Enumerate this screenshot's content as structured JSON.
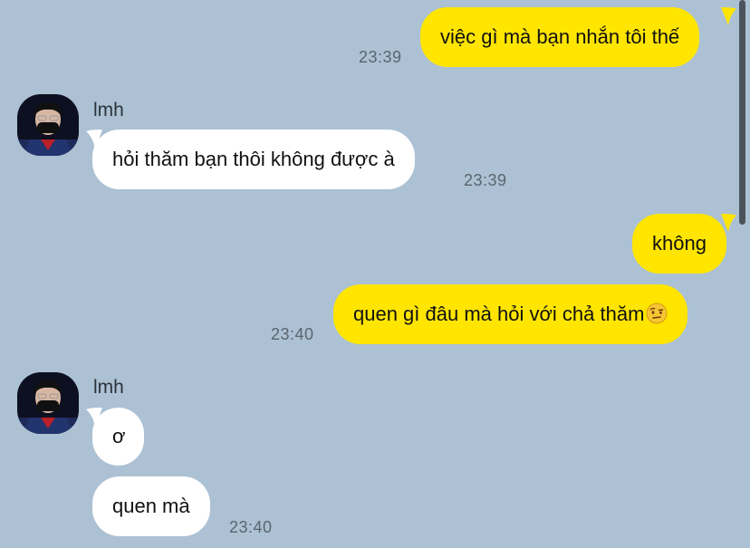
{
  "colors": {
    "background": "#acc1d3",
    "mine_bubble": "#ffe500",
    "their_bubble": "#ffffff",
    "timestamp": "#5a6570"
  },
  "messages": [
    {
      "id": "m1",
      "from": "me",
      "text": "việc gì mà bạn nhắn tôi thế",
      "time": "23:39"
    },
    {
      "id": "m2",
      "from": "lmh",
      "sender": "lmh",
      "text": "hỏi thăm bạn thôi không được à",
      "time": "23:39"
    },
    {
      "id": "m3",
      "from": "me",
      "text": "không"
    },
    {
      "id": "m4",
      "from": "me",
      "text": "quen gì đâu mà hỏi với chả thăm",
      "emoji": "raised-eyebrow-emoji",
      "time": "23:40"
    },
    {
      "id": "m5",
      "from": "lmh",
      "sender": "lmh",
      "text": "ơ"
    },
    {
      "id": "m6",
      "from": "lmh",
      "text": "quen mà",
      "time": "23:40"
    }
  ]
}
